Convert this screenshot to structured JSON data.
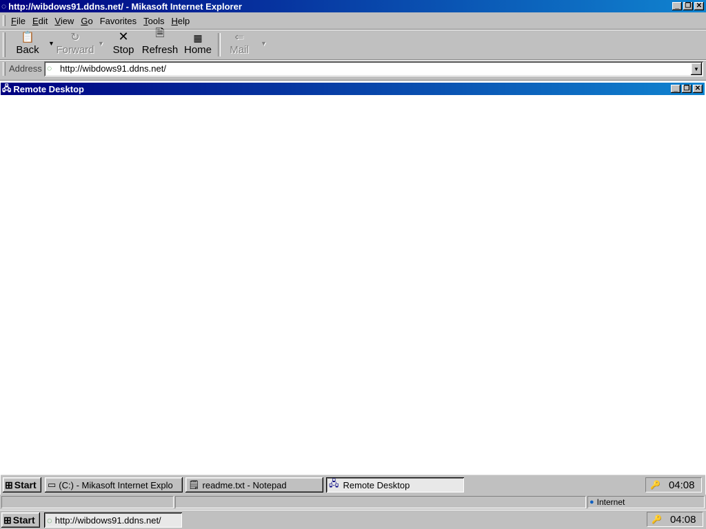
{
  "browser": {
    "title": "http://wibdows91.ddns.net/ - Mikasoft Internet Explorer",
    "menu": [
      {
        "key": "F",
        "rest": "ile"
      },
      {
        "key": "E",
        "rest": "dit"
      },
      {
        "key": "V",
        "rest": "iew"
      },
      {
        "key": "G",
        "rest": "o"
      },
      {
        "key": "",
        "rest": "Favorites",
        "under": "a"
      },
      {
        "key": "T",
        "rest": "ools"
      },
      {
        "key": "H",
        "rest": "elp"
      }
    ],
    "toolbar": {
      "back": "Back",
      "forward": "Forward",
      "stop": "Stop",
      "refresh": "Refresh",
      "home": "Home",
      "mail": "Mail"
    },
    "address_label": "Address",
    "address_value": "http://wibdows91.ddns.net/"
  },
  "remote": {
    "title": "Remote Desktop",
    "taskbar": {
      "start": "Start",
      "tasks": [
        {
          "label": "(C:) - Mikasoft Internet Explo"
        },
        {
          "label": "readme.txt - Notepad"
        },
        {
          "label": "Remote Desktop"
        }
      ],
      "clock": "04:08"
    }
  },
  "statusbar": {
    "zone": "Internet"
  },
  "host_taskbar": {
    "start": "Start",
    "tasks": [
      {
        "label": "http://wibdows91.ddns.net/"
      }
    ],
    "clock": "04:08"
  }
}
